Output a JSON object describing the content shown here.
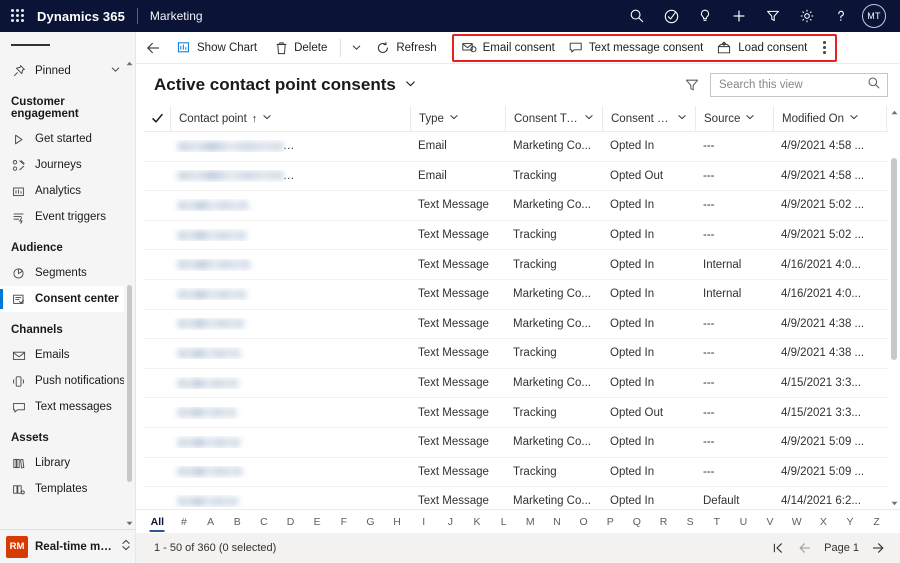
{
  "topbar": {
    "waffle_label": "app-launcher",
    "brand": "Dynamics 365",
    "app_name": "Marketing",
    "icons": [
      {
        "name": "search-icon",
        "label": "Search"
      },
      {
        "name": "task-check-icon",
        "label": "Assistant"
      },
      {
        "name": "lightbulb-icon",
        "label": "Insights"
      },
      {
        "name": "plus-icon",
        "label": "New"
      },
      {
        "name": "filter-icon",
        "label": "Filter"
      },
      {
        "name": "gear-icon",
        "label": "Settings"
      },
      {
        "name": "help-icon",
        "label": "Help"
      }
    ],
    "avatar_initials": "MT",
    "bg_color": "#0b1437"
  },
  "sidebar": {
    "pinned": {
      "label": "Pinned",
      "icon": "pin-icon"
    },
    "groups": [
      {
        "title": "Customer engagement",
        "items": [
          {
            "label": "Get started",
            "icon": "play-icon",
            "selected": false
          },
          {
            "label": "Journeys",
            "icon": "journeys-icon",
            "selected": false
          },
          {
            "label": "Analytics",
            "icon": "analytics-icon",
            "selected": false
          },
          {
            "label": "Event triggers",
            "icon": "trigger-icon",
            "selected": false
          }
        ]
      },
      {
        "title": "Audience",
        "items": [
          {
            "label": "Segments",
            "icon": "segments-icon",
            "selected": false
          },
          {
            "label": "Consent center",
            "icon": "consent-icon",
            "selected": true
          }
        ]
      },
      {
        "title": "Channels",
        "items": [
          {
            "label": "Emails",
            "icon": "email-icon",
            "selected": false
          },
          {
            "label": "Push notifications",
            "icon": "push-icon",
            "selected": false
          },
          {
            "label": "Text messages",
            "icon": "text-message-icon",
            "selected": false
          }
        ]
      },
      {
        "title": "Assets",
        "items": [
          {
            "label": "Library",
            "icon": "library-icon",
            "selected": false
          },
          {
            "label": "Templates",
            "icon": "templates-icon",
            "selected": false
          }
        ]
      }
    ],
    "area_switcher": {
      "badge": "RM",
      "badge_color": "#d83b01",
      "label": "Real-time marketi..."
    }
  },
  "commandbar": {
    "back_label": "Back",
    "buttons": [
      {
        "label": "Show Chart",
        "icon": "chart-icon"
      },
      {
        "label": "Delete",
        "icon": "trash-icon"
      }
    ],
    "caret_label": "More commands",
    "refresh": {
      "label": "Refresh",
      "icon": "refresh-icon"
    },
    "highlighted": {
      "border_color": "#e8211f",
      "buttons": [
        {
          "label": "Email consent",
          "icon": "email-consent-icon"
        },
        {
          "label": "Text message consent",
          "icon": "text-consent-icon"
        },
        {
          "label": "Load consent",
          "icon": "load-consent-icon"
        }
      ],
      "overflow_label": "More commands"
    }
  },
  "view": {
    "title": "Active contact point consents",
    "chevron": "chevron-down-icon",
    "filter_icon": "filter-icon",
    "search_placeholder": "Search this view",
    "search_value": ""
  },
  "grid": {
    "select_all_label": "Select all",
    "columns": [
      {
        "label": "Contact point",
        "sorted": true,
        "sort_glyph": "↑"
      },
      {
        "label": "Type",
        "sorted": false
      },
      {
        "label": "Consent Type Va...",
        "sorted": false
      },
      {
        "label": "Consent status",
        "sorted": false
      },
      {
        "label": "Source",
        "sorted": false
      },
      {
        "label": "Modified On",
        "sorted": false
      }
    ],
    "rows": [
      {
        "contact_point": "",
        "masked": true,
        "mask_widths": [
          105,
          120
        ],
        "type": "Email",
        "consent_type": "Marketing Co...",
        "status": "Opted In",
        "source": "---",
        "modified": "4/9/2021 4:58 ..."
      },
      {
        "contact_point": "",
        "masked": true,
        "mask_widths": [
          105,
          118
        ],
        "type": "Email",
        "consent_type": "Tracking",
        "status": "Opted Out",
        "source": "---",
        "modified": "4/9/2021 4:58 ..."
      },
      {
        "contact_point": "",
        "masked": true,
        "mask_widths": [
          70
        ],
        "type": "Text Message",
        "consent_type": "Marketing Co...",
        "status": "Opted In",
        "source": "---",
        "modified": "4/9/2021 5:02 ..."
      },
      {
        "contact_point": "",
        "masked": true,
        "mask_widths": [
          68
        ],
        "type": "Text Message",
        "consent_type": "Tracking",
        "status": "Opted In",
        "source": "---",
        "modified": "4/9/2021 5:02 ..."
      },
      {
        "contact_point": "",
        "masked": true,
        "mask_widths": [
          72
        ],
        "type": "Text Message",
        "consent_type": "Tracking",
        "status": "Opted In",
        "source": "Internal",
        "modified": "4/16/2021 4:0..."
      },
      {
        "contact_point": "",
        "masked": true,
        "mask_widths": [
          68
        ],
        "type": "Text Message",
        "consent_type": "Marketing Co...",
        "status": "Opted In",
        "source": "Internal",
        "modified": "4/16/2021 4:0..."
      },
      {
        "contact_point": "",
        "masked": true,
        "mask_widths": [
          66
        ],
        "type": "Text Message",
        "consent_type": "Marketing Co...",
        "status": "Opted In",
        "source": "---",
        "modified": "4/9/2021 4:38 ..."
      },
      {
        "contact_point": "",
        "masked": true,
        "mask_widths": [
          62
        ],
        "type": "Text Message",
        "consent_type": "Tracking",
        "status": "Opted In",
        "source": "---",
        "modified": "4/9/2021 4:38 ..."
      },
      {
        "contact_point": "",
        "masked": true,
        "mask_widths": [
          60
        ],
        "type": "Text Message",
        "consent_type": "Marketing Co...",
        "status": "Opted In",
        "source": "---",
        "modified": "4/15/2021 3:3..."
      },
      {
        "contact_point": "",
        "masked": true,
        "mask_widths": [
          58
        ],
        "type": "Text Message",
        "consent_type": "Tracking",
        "status": "Opted Out",
        "source": "---",
        "modified": "4/15/2021 3:3..."
      },
      {
        "contact_point": "",
        "masked": true,
        "mask_widths": [
          62
        ],
        "type": "Text Message",
        "consent_type": "Marketing Co...",
        "status": "Opted In",
        "source": "---",
        "modified": "4/9/2021 5:09 ..."
      },
      {
        "contact_point": "",
        "masked": true,
        "mask_widths": [
          64
        ],
        "type": "Text Message",
        "consent_type": "Tracking",
        "status": "Opted In",
        "source": "---",
        "modified": "4/9/2021 5:09 ..."
      },
      {
        "contact_point": "",
        "masked": true,
        "mask_widths": [
          60
        ],
        "type": "Text Message",
        "consent_type": "Marketing Co...",
        "status": "Opted In",
        "source": "Default",
        "modified": "4/14/2021 6:2..."
      }
    ]
  },
  "alphabar": {
    "items": [
      "All",
      "#",
      "A",
      "B",
      "C",
      "D",
      "E",
      "F",
      "G",
      "H",
      "I",
      "J",
      "K",
      "L",
      "M",
      "N",
      "O",
      "P",
      "Q",
      "R",
      "S",
      "T",
      "U",
      "V",
      "W",
      "X",
      "Y",
      "Z"
    ],
    "selected": "All",
    "accent_color": "#2b579a"
  },
  "statusbar": {
    "record_count": "1 - 50 of 360 (0 selected)",
    "pager": {
      "first_label": "First page",
      "prev_label": "Previous page",
      "page_label": "Page 1",
      "next_label": "Next page"
    }
  }
}
